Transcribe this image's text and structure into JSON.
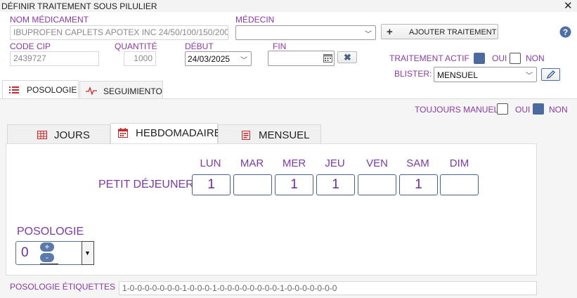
{
  "window": {
    "title": "DÉFINIR TRAITEMENT SOUS PILULIER"
  },
  "form": {
    "nom_medicament_label": "NOM MÉDICAMENT",
    "nom_medicament_value": "IBUPROFEN CAPLETS APOTEX INC 24/50/100/150/200",
    "medecin_label": "MÉDECIN",
    "medecin_value": "",
    "ajouter_label": "AJOUTER TRAITEMENT",
    "code_cip_label": "CODE CIP",
    "code_cip_value": "2439727",
    "quantite_label": "QUANTITÉ",
    "quantite_value": "1000",
    "debut_label": "DÉBUT",
    "debut_value": "24/03/2025",
    "fin_label": "FIN",
    "fin_value": "",
    "traitement_actif_label": "TRAITEMENT ACTIF",
    "traitement_actif_oui": "OUI",
    "traitement_actif_non": "NON",
    "blister_label": "BLISTER:",
    "blister_value": "MENSUEL"
  },
  "main_tabs": [
    {
      "label": "POSOLOGIE",
      "active": true
    },
    {
      "label": "SEGUIMIENTO",
      "active": false
    }
  ],
  "toujours_manuel": {
    "label": "TOUJOURS MANUEL",
    "oui": "OUI",
    "non": "NON"
  },
  "sub_tabs": [
    {
      "label": "JOURS",
      "active": false
    },
    {
      "label": "HEBDOMADAIRE",
      "active": true
    },
    {
      "label": "MENSUEL",
      "active": false
    }
  ],
  "schedule": {
    "row_label": "PETIT DÉJEUNER",
    "days": [
      "LUN",
      "MAR",
      "MER",
      "JEU",
      "VEN",
      "SAM",
      "DIM"
    ],
    "values": [
      "1",
      "",
      "1",
      "1",
      "",
      "1",
      ""
    ]
  },
  "posologie": {
    "label": "POSOLOGIE",
    "value": "0"
  },
  "etiquettes": {
    "label": "POSOLOGIE ÉTIQUETTES",
    "value": "1-0-0-0-0-0-0-0-1-0-0-0-1-0-0-0-0-0-0-0-0-1-0-0-0-0-0-0-0"
  },
  "colors": {
    "label_purple": "#8a3aa6",
    "checkbox_blue": "#4c6a9e",
    "spinner_blue": "#5c79ab"
  },
  "icons": [
    "close-icon",
    "plus-icon",
    "help-icon",
    "calendar-icon",
    "clear-icon",
    "edit-icon",
    "list-icon",
    "pulse-icon",
    "grid-icon",
    "calendar-week-icon",
    "calendar-month-icon",
    "chevron-down-icon"
  ]
}
